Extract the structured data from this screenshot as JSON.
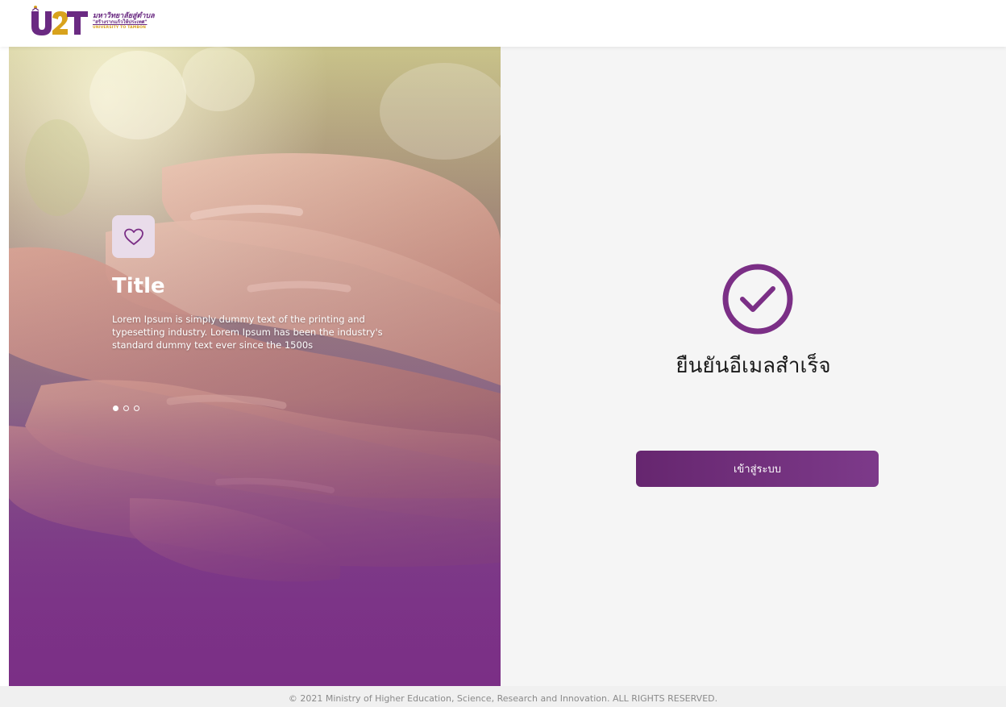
{
  "header": {
    "logo": {
      "mark_text": "U2T",
      "line1": "มหาวิทยาลัยสู่ตำบล",
      "line2": "\"สร้างรากแก้วให้ประเทศ\"",
      "line3": "UNIVERSITY TO TAMBON"
    }
  },
  "hero": {
    "icon": "heart-icon",
    "title": "Title",
    "text": "Lorem Ipsum is simply dummy text of the printing and typesetting industry. Lorem Ipsum has been the industry's standard dummy text ever since the 1500s",
    "slides": 3,
    "active_slide": 1
  },
  "confirmation": {
    "icon": "check-circle-icon",
    "title": "ยืนยันอีเมลสำเร็จ",
    "button_label": "เข้าสู่ระบบ"
  },
  "footer": {
    "copyright": "© 2021 Ministry of Higher Education, Science, Research and Innovation. ALL RIGHTS RESERVED."
  },
  "colors": {
    "brand_purple": "#7b2f86",
    "button_start": "#66266f",
    "button_end": "#7d3a8a",
    "accent_gold": "#d8a21c",
    "panel_bg": "#f5f5f5"
  }
}
